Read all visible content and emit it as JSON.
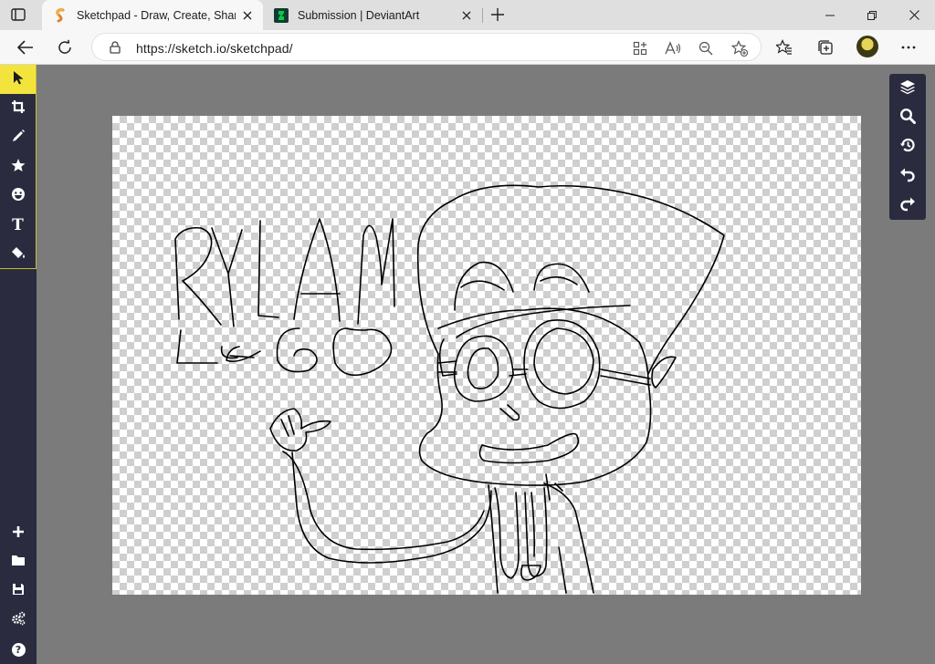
{
  "browser": {
    "tabs": [
      {
        "title": "Sketchpad - Draw, Create, Share!",
        "active": true
      },
      {
        "title": "Submission | DeviantArt",
        "active": false
      }
    ],
    "url": "https://sketch.io/sketchpad/"
  },
  "app": {
    "tools": [
      "select-tool",
      "crop-tool",
      "brush-tool",
      "stamp-tool",
      "emoji-tool",
      "text-tool",
      "fill-tool"
    ],
    "text_tool_glyph": "T",
    "right_panel": [
      "layers",
      "zoom",
      "history",
      "undo",
      "redo"
    ],
    "bottom_tools": [
      "new",
      "open",
      "save",
      "settings",
      "help"
    ],
    "help_glyph": "?"
  },
  "colors": {
    "tool_active": "#f2e43d",
    "sidebar_bg": "#2a2b3f",
    "workspace_bg": "#7b7b7b"
  }
}
